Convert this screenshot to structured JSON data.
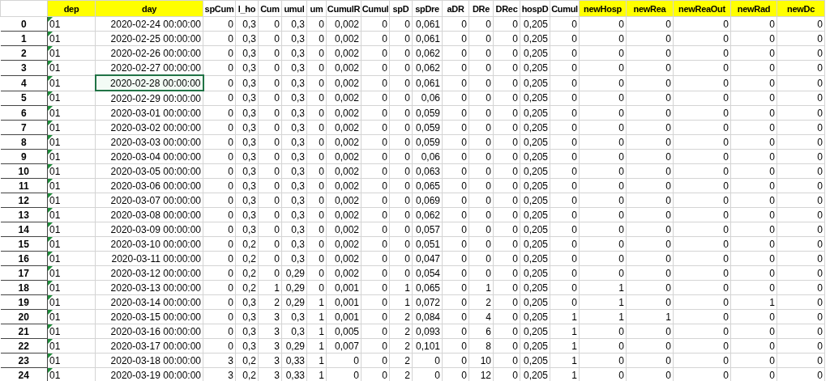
{
  "table": {
    "columns": [
      {
        "label": "dep",
        "highlighted": true
      },
      {
        "label": "day",
        "highlighted": true
      },
      {
        "label": "spCum",
        "highlighted": false
      },
      {
        "label": "l_ho",
        "highlighted": false
      },
      {
        "label": "Cum",
        "highlighted": false
      },
      {
        "label": "umul",
        "highlighted": false
      },
      {
        "label": "um",
        "highlighted": false
      },
      {
        "label": "CumulR",
        "highlighted": false
      },
      {
        "label": "Cumul",
        "highlighted": false
      },
      {
        "label": "spD",
        "highlighted": false
      },
      {
        "label": "spDre",
        "highlighted": false
      },
      {
        "label": "aDR",
        "highlighted": false
      },
      {
        "label": "DRe",
        "highlighted": false
      },
      {
        "label": "DRec",
        "highlighted": false
      },
      {
        "label": "hospD",
        "highlighted": false
      },
      {
        "label": "Cumul",
        "highlighted": false
      },
      {
        "label": "newHosp",
        "highlighted": true
      },
      {
        "label": "newRea",
        "highlighted": true
      },
      {
        "label": "newReaOut",
        "highlighted": true
      },
      {
        "label": "newRad",
        "highlighted": true
      },
      {
        "label": "newDc",
        "highlighted": true
      }
    ],
    "rows": [
      {
        "index": "0",
        "flagged": true,
        "selected": false,
        "cells": [
          "01",
          "2020-02-24 00:00:00",
          "0",
          "0,3",
          "0",
          "0,3",
          "0",
          "0,002",
          "0",
          "0",
          "0,061",
          "0",
          "0",
          "0",
          "0,205",
          "0",
          "0",
          "0",
          "0",
          "0",
          "0"
        ]
      },
      {
        "index": "1",
        "flagged": true,
        "selected": false,
        "cells": [
          "01",
          "2020-02-25 00:00:00",
          "0",
          "0,3",
          "0",
          "0,3",
          "0",
          "0,002",
          "0",
          "0",
          "0,061",
          "0",
          "0",
          "0",
          "0,205",
          "0",
          "0",
          "0",
          "0",
          "0",
          "0"
        ]
      },
      {
        "index": "2",
        "flagged": true,
        "selected": false,
        "cells": [
          "01",
          "2020-02-26 00:00:00",
          "0",
          "0,3",
          "0",
          "0,3",
          "0",
          "0,002",
          "0",
          "0",
          "0,062",
          "0",
          "0",
          "0",
          "0,205",
          "0",
          "0",
          "0",
          "0",
          "0",
          "0"
        ]
      },
      {
        "index": "3",
        "flagged": true,
        "selected": false,
        "cells": [
          "01",
          "2020-02-27 00:00:00",
          "0",
          "0,3",
          "0",
          "0,3",
          "0",
          "0,002",
          "0",
          "0",
          "0,062",
          "0",
          "0",
          "0",
          "0,205",
          "0",
          "0",
          "0",
          "0",
          "0",
          "0"
        ]
      },
      {
        "index": "4",
        "flagged": true,
        "selected": true,
        "cells": [
          "01",
          "2020-02-28 00:00:00",
          "0",
          "0,3",
          "0",
          "0,3",
          "0",
          "0,002",
          "0",
          "0",
          "0,061",
          "0",
          "0",
          "0",
          "0,205",
          "0",
          "0",
          "0",
          "0",
          "0",
          "0"
        ]
      },
      {
        "index": "5",
        "flagged": true,
        "selected": false,
        "cells": [
          "01",
          "2020-02-29 00:00:00",
          "0",
          "0,3",
          "0",
          "0,3",
          "0",
          "0,002",
          "0",
          "0",
          "0,06",
          "0",
          "0",
          "0",
          "0,205",
          "0",
          "0",
          "0",
          "0",
          "0",
          "0"
        ]
      },
      {
        "index": "6",
        "flagged": true,
        "selected": false,
        "cells": [
          "01",
          "2020-03-01 00:00:00",
          "0",
          "0,3",
          "0",
          "0,3",
          "0",
          "0,002",
          "0",
          "0",
          "0,059",
          "0",
          "0",
          "0",
          "0,205",
          "0",
          "0",
          "0",
          "0",
          "0",
          "0"
        ]
      },
      {
        "index": "7",
        "flagged": true,
        "selected": false,
        "cells": [
          "01",
          "2020-03-02 00:00:00",
          "0",
          "0,3",
          "0",
          "0,3",
          "0",
          "0,002",
          "0",
          "0",
          "0,059",
          "0",
          "0",
          "0",
          "0,205",
          "0",
          "0",
          "0",
          "0",
          "0",
          "0"
        ]
      },
      {
        "index": "8",
        "flagged": true,
        "selected": false,
        "cells": [
          "01",
          "2020-03-03 00:00:00",
          "0",
          "0,3",
          "0",
          "0,3",
          "0",
          "0,002",
          "0",
          "0",
          "0,059",
          "0",
          "0",
          "0",
          "0,205",
          "0",
          "0",
          "0",
          "0",
          "0",
          "0"
        ]
      },
      {
        "index": "9",
        "flagged": true,
        "selected": false,
        "cells": [
          "01",
          "2020-03-04 00:00:00",
          "0",
          "0,3",
          "0",
          "0,3",
          "0",
          "0,002",
          "0",
          "0",
          "0,06",
          "0",
          "0",
          "0",
          "0,205",
          "0",
          "0",
          "0",
          "0",
          "0",
          "0"
        ]
      },
      {
        "index": "10",
        "flagged": true,
        "selected": false,
        "cells": [
          "01",
          "2020-03-05 00:00:00",
          "0",
          "0,3",
          "0",
          "0,3",
          "0",
          "0,002",
          "0",
          "0",
          "0,063",
          "0",
          "0",
          "0",
          "0,205",
          "0",
          "0",
          "0",
          "0",
          "0",
          "0"
        ]
      },
      {
        "index": "11",
        "flagged": true,
        "selected": false,
        "cells": [
          "01",
          "2020-03-06 00:00:00",
          "0",
          "0,3",
          "0",
          "0,3",
          "0",
          "0,002",
          "0",
          "0",
          "0,065",
          "0",
          "0",
          "0",
          "0,205",
          "0",
          "0",
          "0",
          "0",
          "0",
          "0"
        ]
      },
      {
        "index": "12",
        "flagged": true,
        "selected": false,
        "cells": [
          "01",
          "2020-03-07 00:00:00",
          "0",
          "0,3",
          "0",
          "0,3",
          "0",
          "0,002",
          "0",
          "0",
          "0,069",
          "0",
          "0",
          "0",
          "0,205",
          "0",
          "0",
          "0",
          "0",
          "0",
          "0"
        ]
      },
      {
        "index": "13",
        "flagged": true,
        "selected": false,
        "cells": [
          "01",
          "2020-03-08 00:00:00",
          "0",
          "0,3",
          "0",
          "0,3",
          "0",
          "0,002",
          "0",
          "0",
          "0,062",
          "0",
          "0",
          "0",
          "0,205",
          "0",
          "0",
          "0",
          "0",
          "0",
          "0"
        ]
      },
      {
        "index": "14",
        "flagged": true,
        "selected": false,
        "cells": [
          "01",
          "2020-03-09 00:00:00",
          "0",
          "0,3",
          "0",
          "0,3",
          "0",
          "0,002",
          "0",
          "0",
          "0,057",
          "0",
          "0",
          "0",
          "0,205",
          "0",
          "0",
          "0",
          "0",
          "0",
          "0"
        ]
      },
      {
        "index": "15",
        "flagged": true,
        "selected": false,
        "cells": [
          "01",
          "2020-03-10 00:00:00",
          "0",
          "0,2",
          "0",
          "0,3",
          "0",
          "0,002",
          "0",
          "0",
          "0,051",
          "0",
          "0",
          "0",
          "0,205",
          "0",
          "0",
          "0",
          "0",
          "0",
          "0"
        ]
      },
      {
        "index": "16",
        "flagged": true,
        "selected": false,
        "cells": [
          "01",
          "2020-03-11 00:00:00",
          "0",
          "0,2",
          "0",
          "0,3",
          "0",
          "0,002",
          "0",
          "0",
          "0,047",
          "0",
          "0",
          "0",
          "0,205",
          "0",
          "0",
          "0",
          "0",
          "0",
          "0"
        ]
      },
      {
        "index": "17",
        "flagged": true,
        "selected": false,
        "cells": [
          "01",
          "2020-03-12 00:00:00",
          "0",
          "0,2",
          "0",
          "0,29",
          "0",
          "0,002",
          "0",
          "0",
          "0,054",
          "0",
          "0",
          "0",
          "0,205",
          "0",
          "0",
          "0",
          "0",
          "0",
          "0"
        ]
      },
      {
        "index": "18",
        "flagged": true,
        "selected": false,
        "cells": [
          "01",
          "2020-03-13 00:00:00",
          "0",
          "0,2",
          "1",
          "0,29",
          "0",
          "0,001",
          "0",
          "1",
          "0,065",
          "0",
          "1",
          "0",
          "0,205",
          "0",
          "1",
          "0",
          "0",
          "0",
          "0"
        ]
      },
      {
        "index": "19",
        "flagged": true,
        "selected": false,
        "cells": [
          "01",
          "2020-03-14 00:00:00",
          "0",
          "0,3",
          "2",
          "0,29",
          "1",
          "0,001",
          "0",
          "1",
          "0,072",
          "0",
          "2",
          "0",
          "0,205",
          "0",
          "1",
          "0",
          "0",
          "1",
          "0"
        ]
      },
      {
        "index": "20",
        "flagged": true,
        "selected": false,
        "cells": [
          "01",
          "2020-03-15 00:00:00",
          "0",
          "0,3",
          "3",
          "0,3",
          "1",
          "0,001",
          "0",
          "2",
          "0,084",
          "0",
          "4",
          "0",
          "0,205",
          "1",
          "1",
          "1",
          "0",
          "0",
          "0"
        ]
      },
      {
        "index": "21",
        "flagged": true,
        "selected": false,
        "cells": [
          "01",
          "2020-03-16 00:00:00",
          "0",
          "0,3",
          "3",
          "0,3",
          "1",
          "0,005",
          "0",
          "2",
          "0,093",
          "0",
          "6",
          "0",
          "0,205",
          "1",
          "0",
          "0",
          "0",
          "0",
          "0"
        ]
      },
      {
        "index": "22",
        "flagged": true,
        "selected": false,
        "cells": [
          "01",
          "2020-03-17 00:00:00",
          "0",
          "0,3",
          "3",
          "0,29",
          "1",
          "0,007",
          "0",
          "2",
          "0,101",
          "0",
          "8",
          "0",
          "0,205",
          "1",
          "0",
          "0",
          "0",
          "0",
          "0"
        ]
      },
      {
        "index": "23",
        "flagged": true,
        "selected": false,
        "cells": [
          "01",
          "2020-03-18 00:00:00",
          "3",
          "0,2",
          "3",
          "0,33",
          "1",
          "0",
          "0",
          "2",
          "0",
          "0",
          "10",
          "0",
          "0,205",
          "1",
          "0",
          "0",
          "0",
          "0",
          "0"
        ]
      },
      {
        "index": "24",
        "flagged": true,
        "selected": false,
        "cells": [
          "01",
          "2020-03-19 00:00:00",
          "3",
          "0,2",
          "3",
          "0,33",
          "1",
          "0",
          "0",
          "2",
          "0",
          "0",
          "12",
          "0",
          "0,205",
          "1",
          "0",
          "0",
          "0",
          "0",
          "0"
        ]
      }
    ]
  }
}
